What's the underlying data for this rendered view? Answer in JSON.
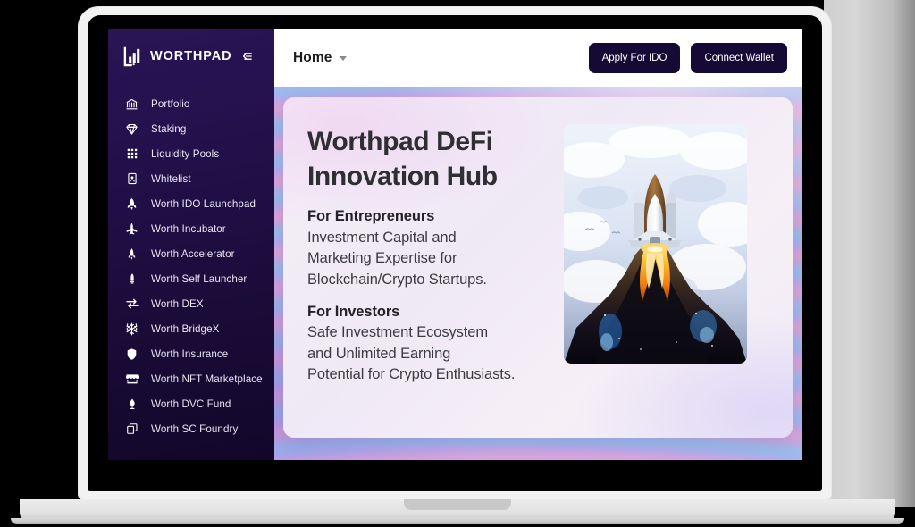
{
  "brand": {
    "name": "WORTHPAD",
    "logo_icon": "worthpad-bars-logo",
    "collapse_icon": "collapse-sidebar-arrow-icon"
  },
  "sidebar": {
    "items": [
      {
        "label": "Portfolio",
        "icon": "bank-icon"
      },
      {
        "label": "Staking",
        "icon": "diamond-icon"
      },
      {
        "label": "Liquidity Pools",
        "icon": "grid-dots-icon"
      },
      {
        "label": "Whitelist",
        "icon": "id-badge-icon"
      },
      {
        "label": "Worth IDO Launchpad",
        "icon": "rocket-icon"
      },
      {
        "label": "Worth Incubator",
        "icon": "jet-plane-icon"
      },
      {
        "label": "Worth Accelerator",
        "icon": "rocket-thin-icon"
      },
      {
        "label": "Worth Self Launcher",
        "icon": "capsule-icon"
      },
      {
        "label": "Worth DEX",
        "icon": "exchange-arrows-icon"
      },
      {
        "label": "Worth BridgeX",
        "icon": "snowflake-icon"
      },
      {
        "label": "Worth Insurance",
        "icon": "shield-icon"
      },
      {
        "label": "Worth NFT Marketplace",
        "icon": "storefront-icon"
      },
      {
        "label": "Worth DVC Fund",
        "icon": "flame-drop-icon"
      },
      {
        "label": "Worth SC Foundry",
        "icon": "copy-layers-icon"
      }
    ]
  },
  "topbar": {
    "menu_label": "Home",
    "caret_icon": "chevron-down-icon",
    "apply_button": "Apply For IDO",
    "connect_button": "Connect Wallet"
  },
  "hero": {
    "title_line1": "Worthpad DeFi",
    "title_line2": "Innovation Hub",
    "entrepreneurs": {
      "heading": "For Entrepreneurs",
      "line1": "Investment Capital and",
      "line2": "Marketing Expertise for",
      "line3": "Blockchain/Crypto Startups."
    },
    "investors": {
      "heading": "For Investors",
      "line1": "Safe Investment Ecosystem",
      "line2": "and Unlimited Earning",
      "line3": "Potential for Crypto Enthusiasts."
    },
    "art_icon": "space-shuttle-launch-illustration"
  },
  "colors": {
    "sidebar_dark": "#22104a",
    "button_dark": "#140a35",
    "card_bg": "#f1ebf7",
    "topbar_bg": "#ffffff"
  }
}
